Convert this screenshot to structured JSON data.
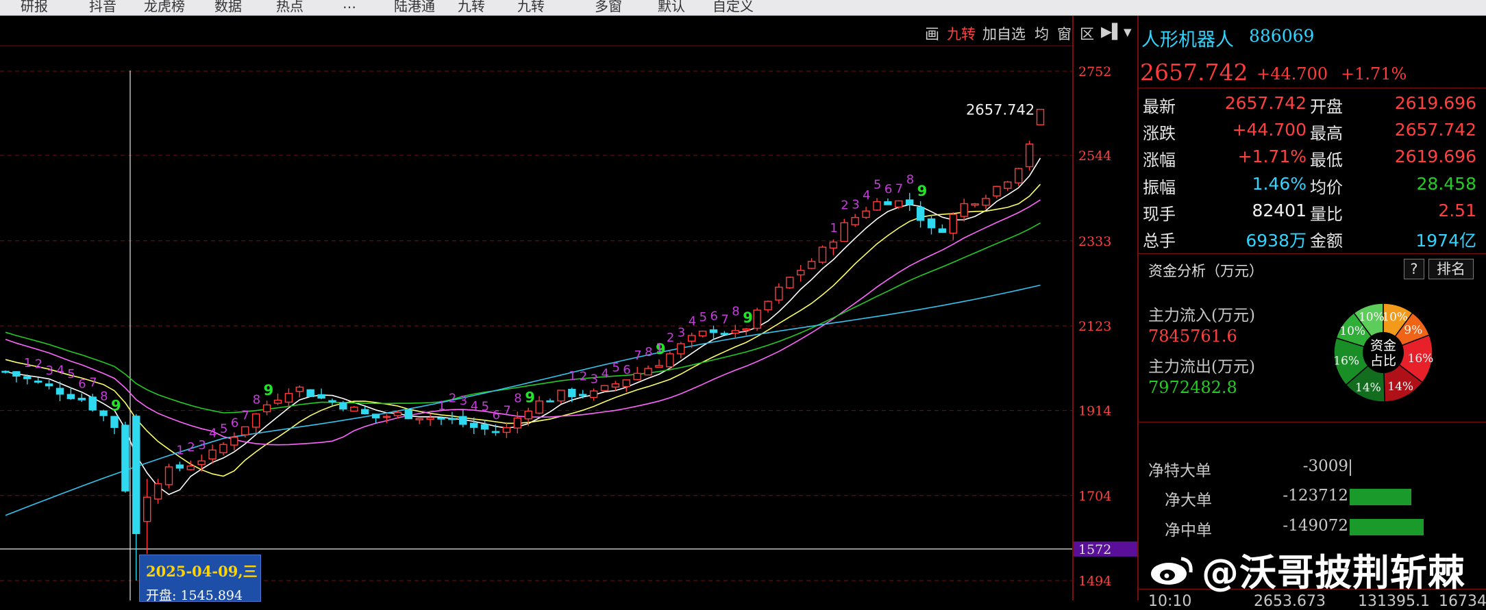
{
  "topbar": {
    "tabs": [
      "研报",
      "抖音",
      "龙虎榜",
      "数据",
      "热点",
      "…",
      "陆港通",
      "九转",
      "九转",
      "多窗",
      "默认",
      "自定义"
    ]
  },
  "chart_toolbar": {
    "items": [
      "画",
      "九转",
      "加自选",
      "均",
      "窗",
      "区",
      "▶▌",
      "▼"
    ]
  },
  "price_axis": {
    "ticks": [
      "2752",
      "2544",
      "2333",
      "2123",
      "1914",
      "1704",
      "1572",
      "1494"
    ],
    "highlight": "1572"
  },
  "last_price_label": "2657.742",
  "cursor_tooltip": {
    "date": "2025-04-09,三",
    "line2": "开盘: 1545.894"
  },
  "stock": {
    "name": "人形机器人",
    "code": "886069",
    "price": "2657.742",
    "change": "+44.700",
    "change_pct": "+1.71%"
  },
  "quote": [
    {
      "l1": "最新",
      "v1": "2657.742",
      "c1": "red",
      "l2": "开盘",
      "v2": "2619.696",
      "c2": "red"
    },
    {
      "l1": "涨跌",
      "v1": "+44.700",
      "c1": "red",
      "l2": "最高",
      "v2": "2657.742",
      "c2": "red"
    },
    {
      "l1": "涨幅",
      "v1": "+1.71%",
      "c1": "red",
      "l2": "最低",
      "v2": "2619.696",
      "c2": "red"
    },
    {
      "l1": "振幅",
      "v1": "1.46%",
      "c1": "cyan",
      "l2": "均价",
      "v2": "28.458",
      "c2": "green"
    },
    {
      "l1": "现手",
      "v1": "82401",
      "c1": "white",
      "l2": "量比",
      "v2": "2.51",
      "c2": "red"
    },
    {
      "l1": "总手",
      "v1": "6938万",
      "c1": "cyan",
      "l2": "金额",
      "v2": "1974亿",
      "c2": "cyan"
    }
  ],
  "fund": {
    "title": "资金分析（万元）",
    "help_btn": "?",
    "rank_btn": "排名",
    "inflow_label": "主力流入(万元)",
    "inflow_value": "7845761.6",
    "outflow_label": "主力流出(万元)",
    "outflow_value": "7972482.8",
    "pie_center": [
      "资金",
      "占比"
    ],
    "pie": [
      {
        "pct": 10,
        "label": "10%",
        "color": "#f39a1a"
      },
      {
        "pct": 9,
        "label": "9%",
        "color": "#f06418"
      },
      {
        "pct": 16,
        "label": "16%",
        "color": "#e8202a"
      },
      {
        "pct": 14,
        "label": "14%",
        "color": "#b01018"
      },
      {
        "pct": 14,
        "label": "14%",
        "color": "#126e1e"
      },
      {
        "pct": 16,
        "label": "16%",
        "color": "#1a8e26"
      },
      {
        "pct": 10,
        "label": "10%",
        "color": "#2fae38"
      },
      {
        "pct": 10,
        "label": "10%",
        "color": "#5ccc5a"
      }
    ],
    "net": [
      {
        "label": "净特大单",
        "value": "-3009",
        "bar": 0
      },
      {
        "label": "净大单",
        "value": "-123712",
        "bar": 0.83
      },
      {
        "label": "净中单",
        "value": "-149072",
        "bar": 1.0
      }
    ]
  },
  "watermark": "@沃哥披荆斩棘",
  "bottom_row": [
    "10:10",
    "2653.673",
    "131395.1",
    "16734"
  ],
  "colors": {
    "up": "#ff3b3b",
    "down": "#2fd9f0",
    "ma5": "#ffffff",
    "ma10": "#ffff66",
    "ma20": "#ff66ff",
    "ma30": "#22cc22",
    "ma60": "#35c4f0",
    "grid": "#7a0e0e"
  }
}
